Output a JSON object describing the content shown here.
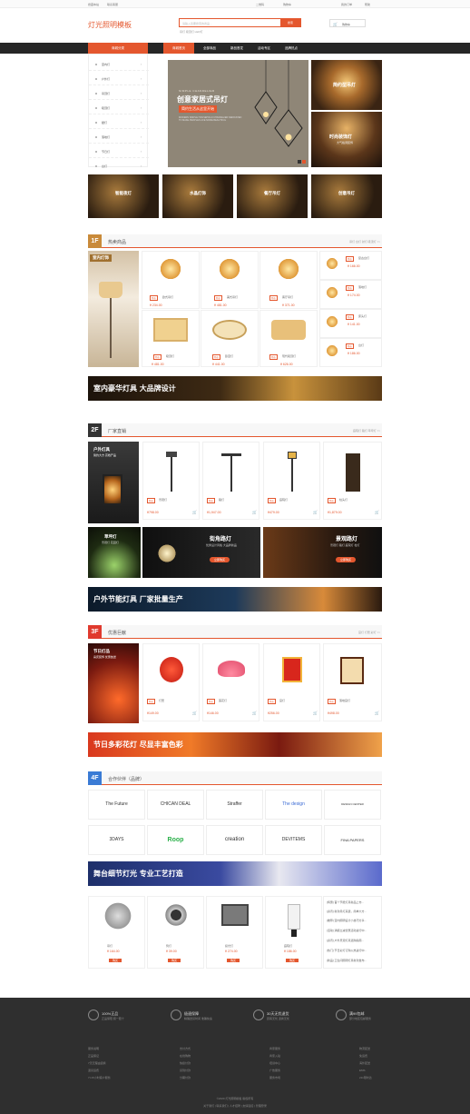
{
  "topbar": {
    "left1": "搜藏本站",
    "left2": "联系客服",
    "right1": "二维码",
    "right2": "购物车",
    "right3": "我的订单",
    "right4": "帮助"
  },
  "header": {
    "logo": "灯光照明模板",
    "search_placeholder": "请输入您要搜索的商品...",
    "search_button": "搜索",
    "hot_words": "吊灯  吸顶灯  LED灯",
    "cart_label": "购物车"
  },
  "nav": {
    "category": "商城分类",
    "items": [
      "商城首页",
      "全部商品",
      "新品首发",
      "活动专区",
      "品牌热点"
    ]
  },
  "side_categories": [
    "室内灯",
    "户外灯",
    "吊顶灯",
    "吸顶灯",
    "壁灯",
    "落地灯",
    "节日灯",
    "台灯"
  ],
  "hero": {
    "en_title": "SIMPLE CHANDELIER",
    "title": "创意家居式吊灯",
    "slogan": "简约生活从这里开始",
    "en_desc": "MODERN SIMPLE HOUSEHOLD CHANDELIER  DEDICATED TO MAKE PEOPLES LIFE  MORE BEAUTIFUL"
  },
  "side_banners": [
    {
      "title": "简约型吊灯"
    },
    {
      "title": "时尚装饰灯",
      "sub": "大气格调装饰"
    }
  ],
  "cat_tiles": [
    "智能夜灯",
    "水晶灯饰",
    "餐厅吊灯",
    "创意吊灯"
  ],
  "floor1": {
    "num": "1F",
    "title": "热卖商品",
    "links": "吊灯  台灯  射灯  吸顶灯  >>",
    "left_label": "室内灯饰",
    "products": [
      {
        "tag": "特价",
        "name": "欧式吊灯",
        "price": "¥ 234.00"
      },
      {
        "tag": "特价",
        "name": "美式吊灯",
        "price": "¥ 481.00"
      },
      {
        "tag": "特价",
        "name": "客厅吊灯",
        "price": "¥ 371.00"
      },
      {
        "tag": "特价",
        "name": "吸顶灯",
        "price": "¥ 481.00"
      },
      {
        "tag": "特价",
        "name": "卧室灯",
        "price": "¥ 441.00"
      },
      {
        "tag": "特价",
        "name": "现代吸顶灯",
        "price": "¥ 626.00"
      }
    ],
    "small_items": [
      {
        "name": "复古台灯",
        "price": "¥ 166.00"
      },
      {
        "name": "落地灯",
        "price": "¥ 174.00"
      },
      {
        "name": "床头灯",
        "price": "¥ 141.00"
      },
      {
        "name": "台灯",
        "price": "¥ 186.00"
      }
    ],
    "banner": "室内豪华灯具 大品牌设计"
  },
  "floor2": {
    "num": "2F",
    "title": "厂家直销",
    "links": "庭院灯  路灯  草坪灯  >>",
    "left_label": "户外灯具",
    "left_sub": "简约大方 高档产品",
    "products": [
      {
        "tag": "特价",
        "name": "景观灯",
        "price": "¥798.00"
      },
      {
        "tag": "特价",
        "name": "路灯",
        "price": "¥1,947.00"
      },
      {
        "tag": "特价",
        "name": "庭院灯",
        "price": "¥479.00"
      },
      {
        "tag": "特价",
        "name": "柱头灯",
        "price": "¥1,879.00"
      }
    ],
    "promo": [
      {
        "title": "草坪灯",
        "sub": "景观灯 花园灯"
      },
      {
        "title": "街角路灯",
        "sub": "优秀设计风格 大品牌新品",
        "btn": "立即购买"
      },
      {
        "title": "景观路灯",
        "sub": "景观灯 路灯 庭院灯 柱灯",
        "btn": "立即购买"
      }
    ],
    "banner": "户外节能灯具 厂家批量生产"
  },
  "floor3": {
    "num": "3F",
    "title": "优惠巨献",
    "links": "宫灯  灯笼  彩灯  >>",
    "left_label": "节日灯品",
    "left_sub": "喜庆装饰 优惠放送",
    "products": [
      {
        "tag": "特价",
        "name": "灯笼",
        "price": "¥149.00"
      },
      {
        "tag": "特价",
        "name": "莲花灯",
        "price": "¥146.00"
      },
      {
        "tag": "特价",
        "name": "宫灯",
        "price": "¥256.00"
      },
      {
        "tag": "特价",
        "name": "落地宫灯",
        "price": "¥498.00"
      }
    ],
    "banner": "节日多彩花灯 尽显丰富色彩"
  },
  "floor4": {
    "num": "4F",
    "title": "合作伙伴（品牌）",
    "brands": [
      "The Future",
      "CHICAN DEAL",
      "Straffer",
      "The design",
      "DESIGN CENTER",
      "3DAYS",
      "Roop",
      "creation",
      "DEVITEMS",
      "FINA PAPERS"
    ],
    "banner": "舞台细节灯光 专业工艺打造",
    "products": [
      {
        "name": "吊灯",
        "price": "¥ 164.00",
        "btn": "购买"
      },
      {
        "name": "筒灯",
        "price": "¥ 39.00",
        "btn": "购买"
      },
      {
        "name": "投光灯",
        "price": "¥ 274.00",
        "btn": "购买"
      },
      {
        "name": "庭院灯",
        "price": "¥ 186.00",
        "btn": "购买"
      }
    ],
    "news": [
      "[特惠] 首个节能灯具新品上市...",
      "[资讯] 新款吊灯来袭，简单大方...",
      "[推荐] 室内照明设计小技巧分享...",
      "[活动] 满额立减优惠活动进行中...",
      "[资讯] 户外景观灯具选购指南...",
      "[热门] 节日彩灯订购火热进行中...",
      "[新品] 卫生间照明灯具新款发布..."
    ]
  },
  "footer": {
    "features": [
      {
        "title": "100%正品",
        "sub": "正品保障 假一赔十"
      },
      {
        "title": "极速保障",
        "sub": "精确送货时间 准确快速"
      },
      {
        "title": "30天无忧退货",
        "sub": "顾客无忧 退换无忧"
      },
      {
        "title": "满99包邮",
        "sub": "部分地区包邮服务"
      }
    ],
    "cols": [
      [
        "服务说明",
        "正品保证",
        "7天无理由退换",
        "退货运费",
        "7×15小时客户服务"
      ],
      [
        "支付方式",
        "在线购物",
        "快捷付款",
        "货到付款",
        "分期付款"
      ],
      [
        "商家服务",
        "商家入驻",
        "培训中心",
        "广告服务",
        "服务市场"
      ],
      [
        "物流配送",
        "免运费",
        "海外配送",
        "EMS",
        "211限时达"
      ]
    ],
    "copyright": "©2020 灯光照明模板 版权所有",
    "links": "关于我们 | 联系我们 | 人才招聘 | 友情链接 | 管理登录"
  }
}
